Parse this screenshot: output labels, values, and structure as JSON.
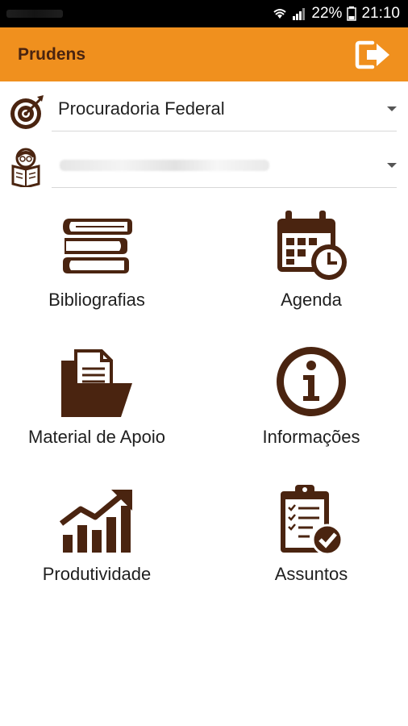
{
  "status_bar": {
    "battery": "22%",
    "time": "21:10"
  },
  "app_bar": {
    "title": "Prudens",
    "logout_icon": "logout-icon"
  },
  "selectors": {
    "area": {
      "value": "Procuradoria Federal",
      "icon": "target-icon"
    },
    "student": {
      "value": "",
      "icon": "reader-icon"
    }
  },
  "menu": {
    "items": [
      {
        "label": "Bibliografias",
        "icon": "books-icon"
      },
      {
        "label": "Agenda",
        "icon": "calendar-clock-icon"
      },
      {
        "label": "Material de Apoio",
        "icon": "folder-documents-icon"
      },
      {
        "label": "Informações",
        "icon": "info-icon"
      },
      {
        "label": "Produtividade",
        "icon": "chart-growth-icon"
      },
      {
        "label": "Assuntos",
        "icon": "clipboard-check-icon"
      }
    ]
  },
  "colors": {
    "accent": "#f0901e",
    "icon_brown": "#4a2410",
    "status_bar": "#000000"
  }
}
